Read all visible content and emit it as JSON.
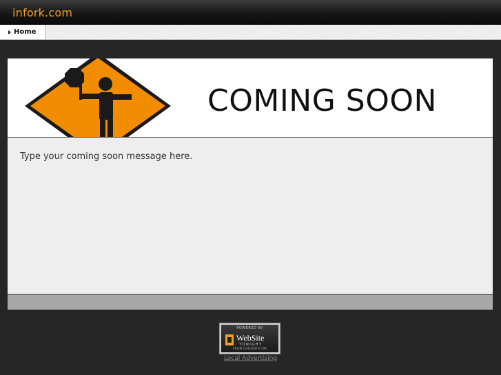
{
  "header": {
    "site_title": "infork.com"
  },
  "nav": {
    "items": [
      {
        "label": "Home"
      }
    ]
  },
  "banner": {
    "text": "COMING SOON"
  },
  "content": {
    "message": "Type your coming soon message here."
  },
  "badge": {
    "top": "POWERED BY",
    "main": "WebSite",
    "sub": "TONIGHT",
    "from": "FROM GODADDY.COM",
    "icon": "websitetonight-logo-icon"
  },
  "footer": {
    "link": "Local Advertising"
  },
  "colors": {
    "title": "#f0a020",
    "sign_orange": "#f28c00",
    "background": "#262626",
    "content_bg": "#eeeeee",
    "footer_bar": "#a8a8a8"
  }
}
